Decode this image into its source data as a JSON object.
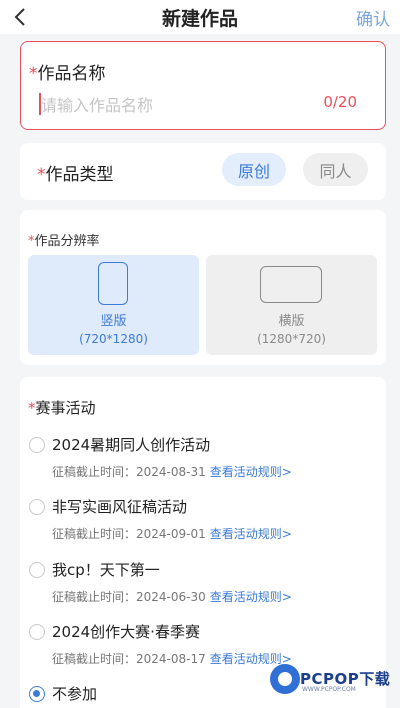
{
  "header": {
    "title": "新建作品",
    "confirm_label": "确认"
  },
  "name_field": {
    "required_mark": "*",
    "label": "作品名称",
    "placeholder": "请输入作品名称",
    "value": "",
    "counter": "0/20"
  },
  "work_type": {
    "required_mark": "*",
    "label": "作品类型",
    "options": [
      {
        "label": "原创",
        "selected": true
      },
      {
        "label": "同人",
        "selected": false
      }
    ]
  },
  "resolution": {
    "required_mark": "*",
    "label": "作品分辨率",
    "options": [
      {
        "name": "竖版",
        "size": "(720*1280)",
        "selected": true,
        "icon": "portrait-phone-icon"
      },
      {
        "name": "横版",
        "size": "(1280*720)",
        "selected": false,
        "icon": "landscape-phone-icon"
      }
    ]
  },
  "events": {
    "required_mark": "*",
    "label": "赛事活动",
    "deadline_prefix": "征稿截止时间：",
    "link_label": "查看活动规则>",
    "items": [
      {
        "title": "2024暑期同人创作活动",
        "deadline": "2024-08-31",
        "selected": false
      },
      {
        "title": "非写实画风征稿活动",
        "deadline": "2024-09-01",
        "selected": false
      },
      {
        "title": "我cp！天下第一",
        "deadline": "2024-06-30",
        "selected": false
      },
      {
        "title": "2024创作大赛·春季赛",
        "deadline": "2024-08-17",
        "selected": false
      }
    ],
    "none_option": {
      "title": "不参加",
      "selected": true
    }
  },
  "watermark": {
    "text": "PCPOP下载",
    "sub": "WWW.PCPOP.COM"
  },
  "colors": {
    "accent": "#3c7bd6",
    "required": "#e9505c",
    "confirm": "#7aa6df"
  }
}
